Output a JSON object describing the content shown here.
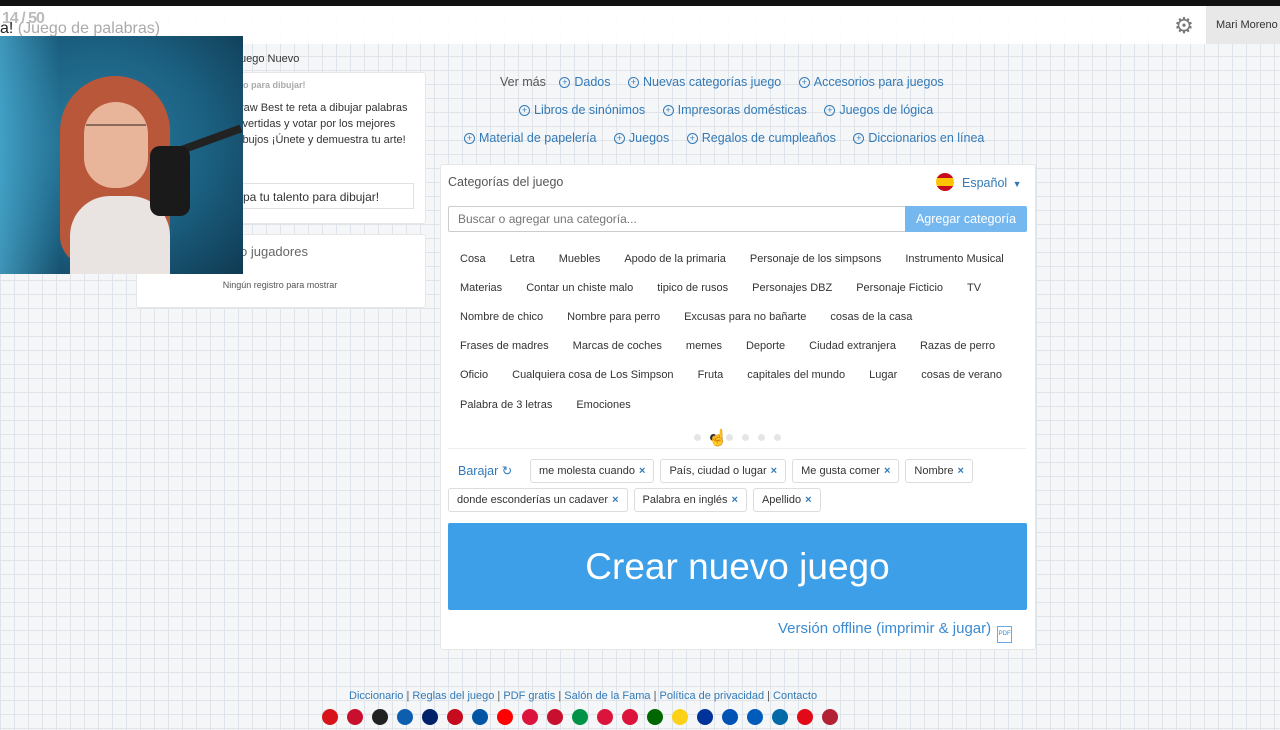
{
  "header": {
    "title_prefix": "a!",
    "title_sub": "(Juego de palabras)",
    "counter": "14 / 50",
    "user_name": "Mari Moreno"
  },
  "left_panel": {
    "new_game": "uego Nuevo",
    "draw_heading": "to para dibujar!",
    "draw_description": "raw Best te reta a dibujar palabras ivertidas y votar por los mejores ibujos ¡Únete y demuestra tu arte!",
    "talent_button": "pa tu talento para dibujar!",
    "players_label": "o jugadores",
    "no_records": "Ningún registro para mostrar"
  },
  "see_more": {
    "label": "Ver más",
    "row1": [
      "Dados",
      "Nuevas categorías juego",
      "Accesorios para juegos"
    ],
    "row2": [
      "Libros de sinónimos",
      "Impresoras domésticas",
      "Juegos de lógica"
    ],
    "row3": [
      "Material de papelería",
      "Juegos",
      "Regalos de cumpleaños",
      "Diccionarios en línea"
    ]
  },
  "categories": {
    "title": "Categorías del juego",
    "language": "Español",
    "search_placeholder": "Buscar o agregar una categoría...",
    "add_button": "Agregar categoría",
    "rows": [
      [
        "Cosa",
        "Letra",
        "Muebles",
        "Apodo de la primaria",
        "Personaje de los simpsons",
        "Instrumento Musical"
      ],
      [
        "Materias",
        "Contar un chiste malo",
        "tipico de rusos",
        "Personajes DBZ",
        "Personaje Ficticio",
        "TV"
      ],
      [
        "Nombre de chico",
        "Nombre para perro",
        "Excusas para no bañarte",
        "cosas de la casa"
      ],
      [
        "Frases de madres",
        "Marcas de coches",
        "memes",
        "Deporte",
        "Ciudad extranjera",
        "Razas de perro"
      ],
      [
        "Oficio",
        "Cualquiera cosa de Los Simpson",
        "Fruta",
        "capitales del mundo",
        "Lugar",
        "cosas de verano"
      ],
      [
        "Palabra de 3 letras",
        "Emociones"
      ]
    ],
    "page_count": 6,
    "active_page": 2
  },
  "selected": {
    "shuffle_label": "Barajar",
    "row1": [
      "me molesta cuando",
      "País, ciudad o lugar",
      "Me gusta comer",
      "Nombre"
    ],
    "row2": [
      "donde esconderías un cadaver",
      "Palabra en inglés",
      "Apellido"
    ]
  },
  "create_button": "Crear nuevo juego",
  "offline_link": "Versión offline (imprimir & jugar)",
  "footer": {
    "links": [
      "Diccionario",
      "Reglas del juego",
      "PDF gratis",
      "Salón de la Fama",
      "Política de privacidad",
      "Contacto"
    ],
    "flag_colors": [
      "#d7141a",
      "#c8102e",
      "#222222",
      "#0d5eaf",
      "#012169",
      "#c60b1e",
      "#0055a4",
      "#ff0000",
      "#dc143c",
      "#c8102e",
      "#009246",
      "#dc143c",
      "#dc143c",
      "#006600",
      "#fcd116",
      "#003399",
      "#0052b4",
      "#005bbb",
      "#006aa7",
      "#e30a17",
      "#b22234"
    ]
  }
}
